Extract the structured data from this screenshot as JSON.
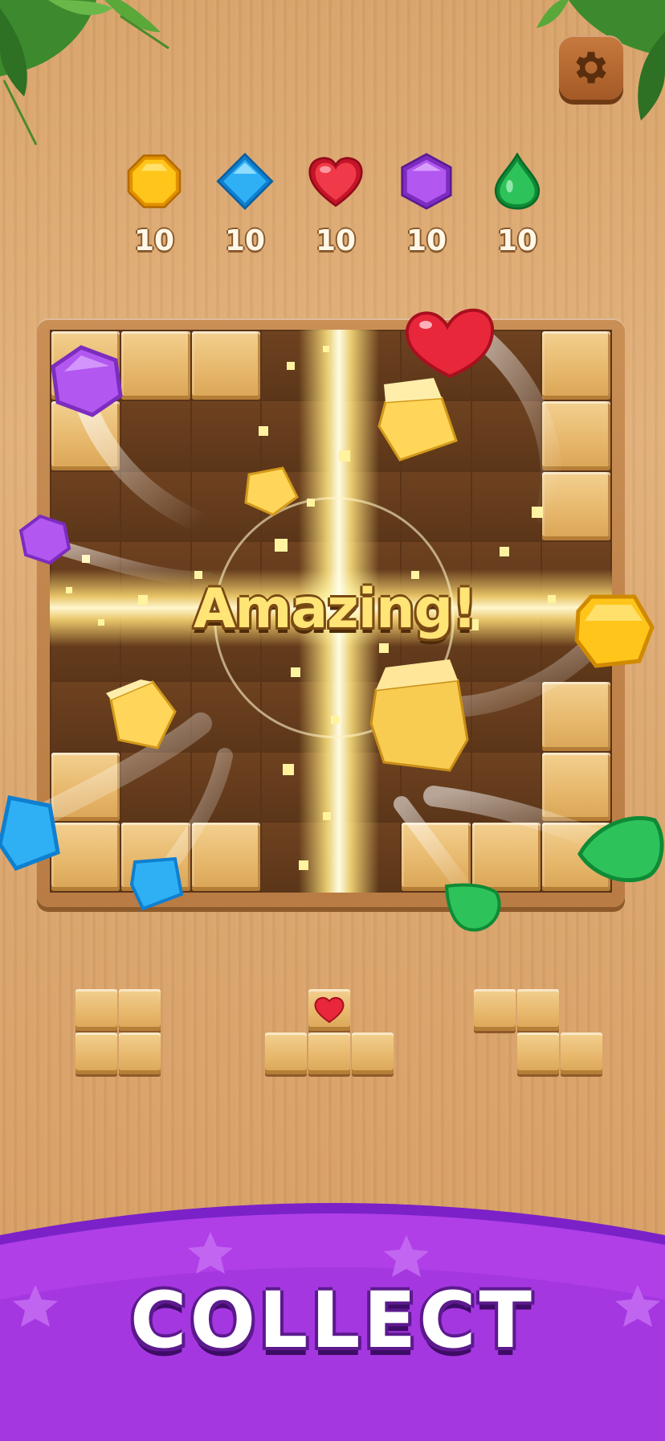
{
  "goals": [
    {
      "icon": "octagon-gem-icon",
      "color": "#f7b500",
      "count": "10"
    },
    {
      "icon": "diamond-gem-icon",
      "color": "#1e9be8",
      "count": "10"
    },
    {
      "icon": "heart-gem-icon",
      "color": "#e8273a",
      "count": "10"
    },
    {
      "icon": "hexagon-gem-icon",
      "color": "#a34be0",
      "count": "10"
    },
    {
      "icon": "drop-gem-icon",
      "color": "#1ea84a",
      "count": "10"
    }
  ],
  "board": {
    "size": 8,
    "filled": [
      [
        1,
        1,
        1,
        0,
        0,
        0,
        0,
        1
      ],
      [
        1,
        0,
        0,
        0,
        0,
        0,
        0,
        1
      ],
      [
        0,
        0,
        0,
        0,
        0,
        0,
        0,
        1
      ],
      [
        0,
        0,
        0,
        0,
        0,
        0,
        0,
        0
      ],
      [
        0,
        0,
        0,
        0,
        0,
        0,
        0,
        0
      ],
      [
        0,
        0,
        0,
        0,
        0,
        0,
        0,
        1
      ],
      [
        1,
        0,
        0,
        0,
        0,
        0,
        0,
        1
      ],
      [
        1,
        1,
        1,
        0,
        0,
        1,
        1,
        1
      ]
    ]
  },
  "combo_text": "Amazing!",
  "pieces": [
    {
      "name": "square-piece",
      "shape": [
        [
          1,
          1
        ],
        [
          1,
          1
        ]
      ]
    },
    {
      "name": "t-piece",
      "shape": [
        [
          0,
          2,
          0
        ],
        [
          1,
          1,
          1
        ]
      ]
    },
    {
      "name": "z-piece",
      "shape": [
        [
          1,
          1,
          0
        ],
        [
          0,
          1,
          1
        ]
      ]
    }
  ],
  "banner": {
    "label": "COLLECT",
    "color": "#b03fe8"
  },
  "settings_icon": "gear-icon"
}
